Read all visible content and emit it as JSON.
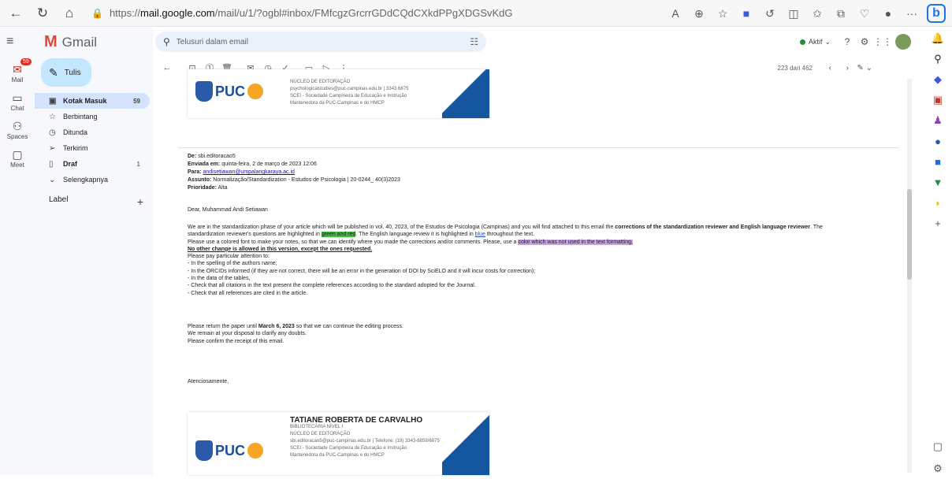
{
  "browser": {
    "url_host": "mail.google.com",
    "url_prefix": "https://",
    "url_path": "/mail/u/1/?ogbl#inbox/FMfcgzGrcrrGDdCQdCXkdPPgXDGSvKdG"
  },
  "app": {
    "name": "Gmail"
  },
  "rail": [
    {
      "label": "Mail",
      "badge": "59"
    },
    {
      "label": "Chat"
    },
    {
      "label": "Spaces"
    },
    {
      "label": "Meet"
    }
  ],
  "sidebar": {
    "compose": "Tulis",
    "items": [
      {
        "label": "Kotak Masuk",
        "count": "59"
      },
      {
        "label": "Berbintang",
        "count": ""
      },
      {
        "label": "Ditunda",
        "count": ""
      },
      {
        "label": "Terkirim",
        "count": ""
      },
      {
        "label": "Draf",
        "count": "1"
      },
      {
        "label": "Selengkapnya",
        "count": ""
      }
    ],
    "label_header": "Label"
  },
  "search": {
    "placeholder": "Telusuri dalam email"
  },
  "status": {
    "label": "Aktif"
  },
  "toolbar": {
    "count": "223 dari 462"
  },
  "sig_top": {
    "line1": "NÚCLEO DE EDITORAÇÃO",
    "line2": "psychologicalstudies@puc-campinas.edu.br  |  3343.6875",
    "line3": "SCEI - Sociedade Campineira de Educação e Instrução",
    "line4": "Mantenedora da PUC-Campinas e do HMCP"
  },
  "email_header": {
    "from_label": "De:",
    "from": "sbi.editoracao5",
    "sent_label": "Enviada em:",
    "sent": "quinta-feira, 2 de março de 2023 12:06",
    "to_label": "Para:",
    "to": "andisetiawan@umpalangkaraya.ac.id",
    "subject_label": "Assunto:",
    "subject": "Normalização/Standardization - Estudos de Psicologia | 20-0244_ 40(3)2023",
    "priority_label": "Prioridade:",
    "priority": "Alta"
  },
  "body": {
    "greeting": "Dear, Muhammad Andi Setiawan",
    "p1a": "We are in the standardization phase of your article which will be published in vol. 40, 2023, of the Estudos de Psicologia (Campinas) and you will find attached to this email the ",
    "p1b": "corrections of the standardization reviewer and English language reviewer",
    "p1c": ". The",
    "p2a": "standardization reviewer's questions are highlighted in ",
    "p2b": "green and red",
    "p2c": ". The English language review it is highlighted in ",
    "p2d": "blue",
    "p2e": " throughout the text.",
    "p3a": "Please use a colored font to make your notes, so that we can identify where you made the corrections and/or comments. Please, use a ",
    "p3b": "color which was not used in the text formatting.",
    "p4": " No other change is allowed in this version, except the ones requested.",
    "p5": " Please pay particular attention to:",
    "l1": "- In the spelling of the authors name;",
    "l2": "- In the ORCIDs informed (if they are not correct, there will be an error in the generation of DOI by SciELO and it will incur costs for correction);",
    "l3": "- In the data of the tables,",
    "l4": "- Check that all citations in the text present the complete references according to the standard adopted for the Journal.",
    "l5": "- Check that all references are cited in the article.",
    "r1a": "Please return the paper until ",
    "r1b": "March 6, 2023",
    "r1c": " so that we can continue the editing process.",
    "r2": "We remain at your disposal to clarify any doubts.",
    "r3": "Please confirm the receipt of this email.",
    "closing": "Atenciosamente,"
  },
  "sig_bottom": {
    "name": "TATIANE ROBERTA DE CARVALHO",
    "line1": "BIBLIOTECÁRIA NÍVEL I",
    "line2": "NÚCLEO DE EDITORAÇÃO",
    "line3": "sbi.editoracao5@puc-campinas.edu.br  |  Telefone: (19) 3343-6859/6875",
    "line4": "SCEI - Sociedade Campineira de Educação e Instrução",
    "line5": "Mantenedora da PUC-Campinas e do HMCP"
  },
  "logo_text": "PUC"
}
